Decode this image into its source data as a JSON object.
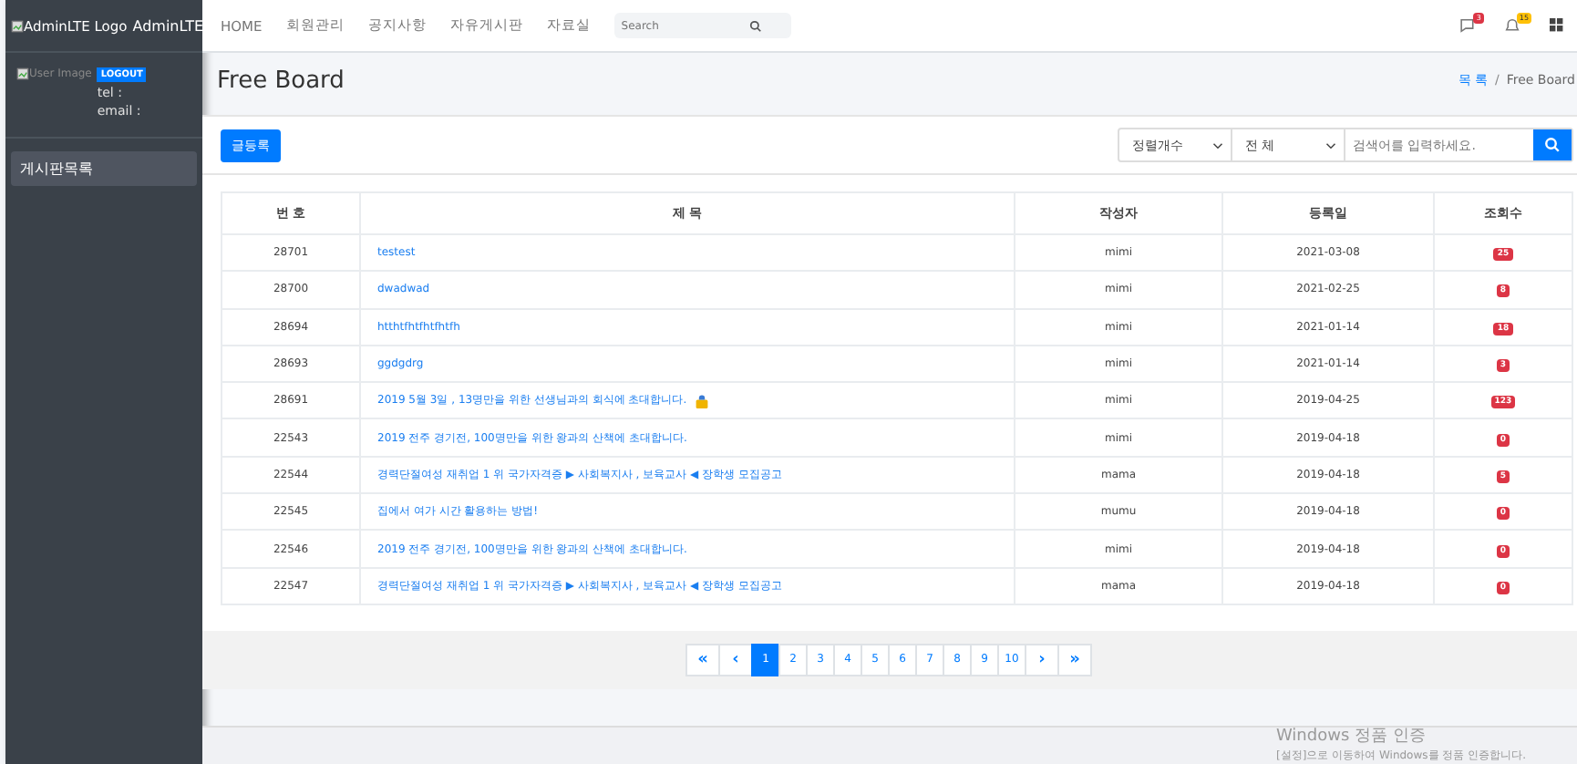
{
  "sidebar": {
    "logo_alt": "AdminLTE Logo",
    "brand": "AdminLTE",
    "user_image_alt": "User Image",
    "logout": "LOGOUT",
    "tel": "tel :",
    "email": "email :",
    "menu": [
      {
        "label": "게시판목록",
        "selected": true
      }
    ]
  },
  "navbar": {
    "links": [
      "HOME",
      "회원관리",
      "공지사항",
      "자유게시판",
      "자료실"
    ],
    "search_placeholder": "Search",
    "messages_badge": "3",
    "notifications_badge": "15"
  },
  "header": {
    "title": "Free Board",
    "breadcrumb_separator": "/",
    "breadcrumb": [
      {
        "label": "목 록",
        "link": true
      },
      {
        "label": "Free Board",
        "link": false
      }
    ]
  },
  "toolbar": {
    "write_button": "글등록",
    "sort_select": "정렬개수",
    "field_select": "전 체",
    "search_placeholder": "검색어를 입력하세요."
  },
  "table": {
    "columns": [
      "번 호",
      "제 목",
      "작성자",
      "등록일",
      "조회수"
    ],
    "rows": [
      {
        "no": "28701",
        "title": "testest",
        "author": "mimi",
        "date": "2021-03-08",
        "views": "25",
        "locked": false
      },
      {
        "no": "28700",
        "title": "dwadwad",
        "author": "mimi",
        "date": "2021-02-25",
        "views": "8",
        "locked": false
      },
      {
        "no": "28694",
        "title": "htthtfhtfhtfhtfh",
        "author": "mimi",
        "date": "2021-01-14",
        "views": "18",
        "locked": false
      },
      {
        "no": "28693",
        "title": "ggdgdrg",
        "author": "mimi",
        "date": "2021-01-14",
        "views": "3",
        "locked": false
      },
      {
        "no": "28691",
        "title": "2019 5월 3일 , 13명만을 위한 선생님과의 회식에 초대합니다.",
        "author": "mimi",
        "date": "2019-04-25",
        "views": "123",
        "locked": true
      },
      {
        "no": "22543",
        "title": "2019 전주 경기전, 100명만을 위한 왕과의 산책에 초대합니다.",
        "author": "mimi",
        "date": "2019-04-18",
        "views": "0",
        "locked": false
      },
      {
        "no": "22544",
        "title": "경력단절여성 재취업 1 위 국가자격증 ▶ 사회복지사 , 보육교사 ◀ 장학생 모집공고",
        "author": "mama",
        "date": "2019-04-18",
        "views": "5",
        "locked": false
      },
      {
        "no": "22545",
        "title": "집에서 여가 시간 활용하는 방법!",
        "author": "mumu",
        "date": "2019-04-18",
        "views": "0",
        "locked": false
      },
      {
        "no": "22546",
        "title": "2019 전주 경기전, 100명만을 위한 왕과의 산책에 초대합니다.",
        "author": "mimi",
        "date": "2019-04-18",
        "views": "0",
        "locked": false
      },
      {
        "no": "22547",
        "title": "경력단절여성 재취업 1 위 국가자격증 ▶ 사회복지사 , 보육교사 ◀ 장학생 모집공고",
        "author": "mama",
        "date": "2019-04-18",
        "views": "0",
        "locked": false
      }
    ]
  },
  "pagination": {
    "first": "«",
    "prev": "‹",
    "next": "›",
    "last": "»",
    "pages": [
      {
        "label": "1",
        "selected": true
      },
      {
        "label": "2",
        "selected": false
      },
      {
        "label": "3",
        "selected": false
      },
      {
        "label": "4",
        "selected": false
      },
      {
        "label": "5",
        "selected": false
      },
      {
        "label": "6",
        "selected": false
      },
      {
        "label": "7",
        "selected": false
      },
      {
        "label": "8",
        "selected": false
      },
      {
        "label": "9",
        "selected": false
      },
      {
        "label": "10",
        "selected": false
      }
    ]
  },
  "os_notice": {
    "title": "Windows 정품 인증",
    "text": "[설정]으로 이동하여 Windows를 정품 인증합니다."
  }
}
